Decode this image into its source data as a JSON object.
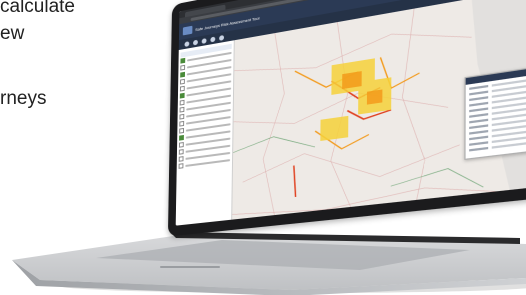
{
  "marketing": {
    "line1": "calculate",
    "line2": "ew",
    "line3": "rneys"
  },
  "app": {
    "title": "Safe Journeys Risk Assessment Tool"
  },
  "colors": {
    "bezel": "#1b1b1d",
    "app_header": "#2b3a55",
    "risk_high": "#e0401f",
    "risk_medium": "#f39a1b",
    "risk_low": "#f6d23a",
    "map_bg": "#eeeae6"
  },
  "icons": [
    "layers-icon",
    "search-icon",
    "zoom-in-icon",
    "zoom-out-icon",
    "home-icon"
  ]
}
